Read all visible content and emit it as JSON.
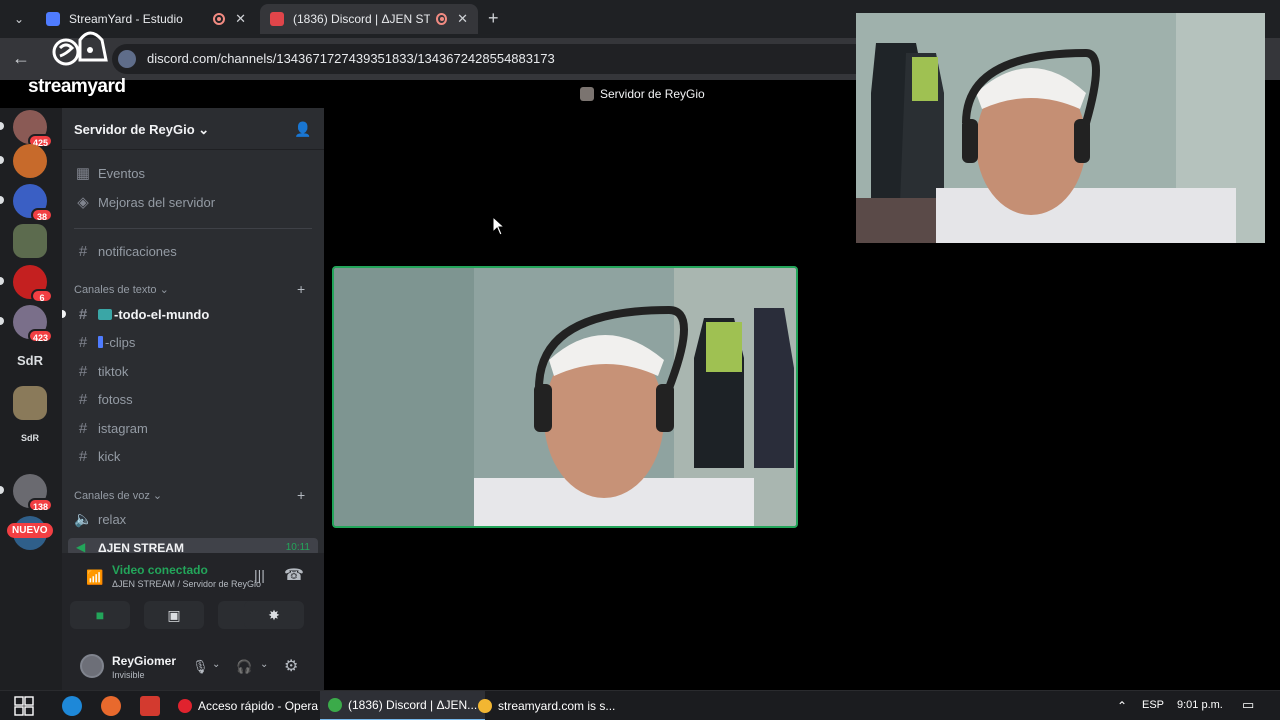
{
  "browser": {
    "tabs": [
      {
        "title": "StreamYard - Estudio",
        "active": false
      },
      {
        "title": "(1836) Discord | ΔJEN STREA",
        "active": true
      }
    ],
    "url": "discord.com/channels/1343671727439351833/1343672428554883173"
  },
  "watermark": {
    "brand": "streamyard"
  },
  "servers": {
    "badges": [
      "425",
      "38",
      "6",
      "423",
      "138"
    ],
    "text_servers": [
      "SdR",
      "SdR"
    ],
    "new_label": "NUEVO"
  },
  "guild": {
    "name": "Servidor de ReyGio",
    "chevron": "⌄",
    "top_items": [
      {
        "label": "Eventos",
        "icon": "calendar-icon"
      },
      {
        "label": "Mejoras del servidor",
        "icon": "boost-icon"
      },
      {
        "label": "notificaciones",
        "icon": "hash-icon"
      }
    ],
    "text_category": "Canales de texto",
    "text_channels": [
      "-todo-el-mundo",
      "-clips",
      "tiktok",
      "fotoss",
      "istagram",
      "kick"
    ],
    "voice_category": "Canales de voz",
    "voice_channels": [
      "relax"
    ],
    "live_channel": {
      "name": "ΔJEN STREAM",
      "time": "10:11"
    }
  },
  "voice_panel": {
    "status": "Video conectado",
    "location": "ΔJEN STREAM / Servidor de ReyGio"
  },
  "user": {
    "name": "ReyGiomer",
    "status": "Invisible"
  },
  "stage": {
    "channel_title": "Servidor de ReyGio"
  },
  "taskbar": {
    "apps": [
      {
        "label": "Acceso rápido - Opera",
        "active": false
      },
      {
        "label": "(1836) Discord | ΔJEN...",
        "active": true
      },
      {
        "label": "streamyard.com is s...",
        "active": false
      }
    ],
    "lang": "ESP",
    "time": "9:01 p.m."
  },
  "colors": {
    "discord_green": "#23a55a",
    "badge_red": "#f23f43",
    "channel_bg": "#2b2d31",
    "server_bg": "#1e1f22"
  }
}
